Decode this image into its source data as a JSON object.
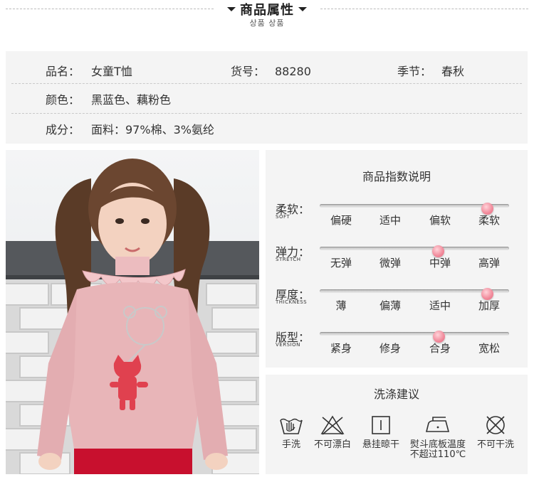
{
  "header": {
    "title": "商品属性",
    "subtitle": "상품 상품"
  },
  "attributes": [
    {
      "label": "品名：",
      "value": "女童T恤"
    },
    {
      "label": "货号：",
      "value": "88280"
    },
    {
      "label": "季节：",
      "value": "春秋"
    },
    {
      "label": "颜色：",
      "value": "黑蓝色、藕粉色"
    },
    {
      "label": "成分：",
      "value": "面料：97%棉、3%氨纶"
    }
  ],
  "index_panel": {
    "title": "商品指数说明",
    "rows": [
      {
        "label": "柔软：",
        "en": "SOFT",
        "options": [
          "偏硬",
          "适中",
          "偏软",
          "柔软"
        ],
        "selected": "柔软"
      },
      {
        "label": "弹力：",
        "en": "STRETCH",
        "options": [
          "无弹",
          "微弹",
          "中弹",
          "高弹"
        ],
        "selected": "中弹"
      },
      {
        "label": "厚度：",
        "en": "THICKNESS",
        "options": [
          "薄",
          "偏薄",
          "适中",
          "加厚"
        ],
        "selected": "加厚"
      },
      {
        "label": "版型：",
        "en": "VERSION",
        "options": [
          "紧身",
          "修身",
          "合身",
          "宽松"
        ],
        "selected": "合身"
      }
    ]
  },
  "wash_panel": {
    "title": "洗涤建议",
    "items": [
      {
        "icon": "hand-wash-icon",
        "label": "手洗"
      },
      {
        "icon": "no-bleach-icon",
        "label": "不可漂白"
      },
      {
        "icon": "hang-dry-icon",
        "label": "悬挂晾干"
      },
      {
        "icon": "iron-icon",
        "label": "熨斗底板温度",
        "label2": "不超过110℃"
      },
      {
        "icon": "no-dry-clean-icon",
        "label": "不可干洗"
      }
    ]
  },
  "colors": {
    "accent_knob": "#f1899a",
    "panel_bg": "#f4f4f4",
    "shirt": "#e8b5b8",
    "pants": "#c8102e"
  }
}
